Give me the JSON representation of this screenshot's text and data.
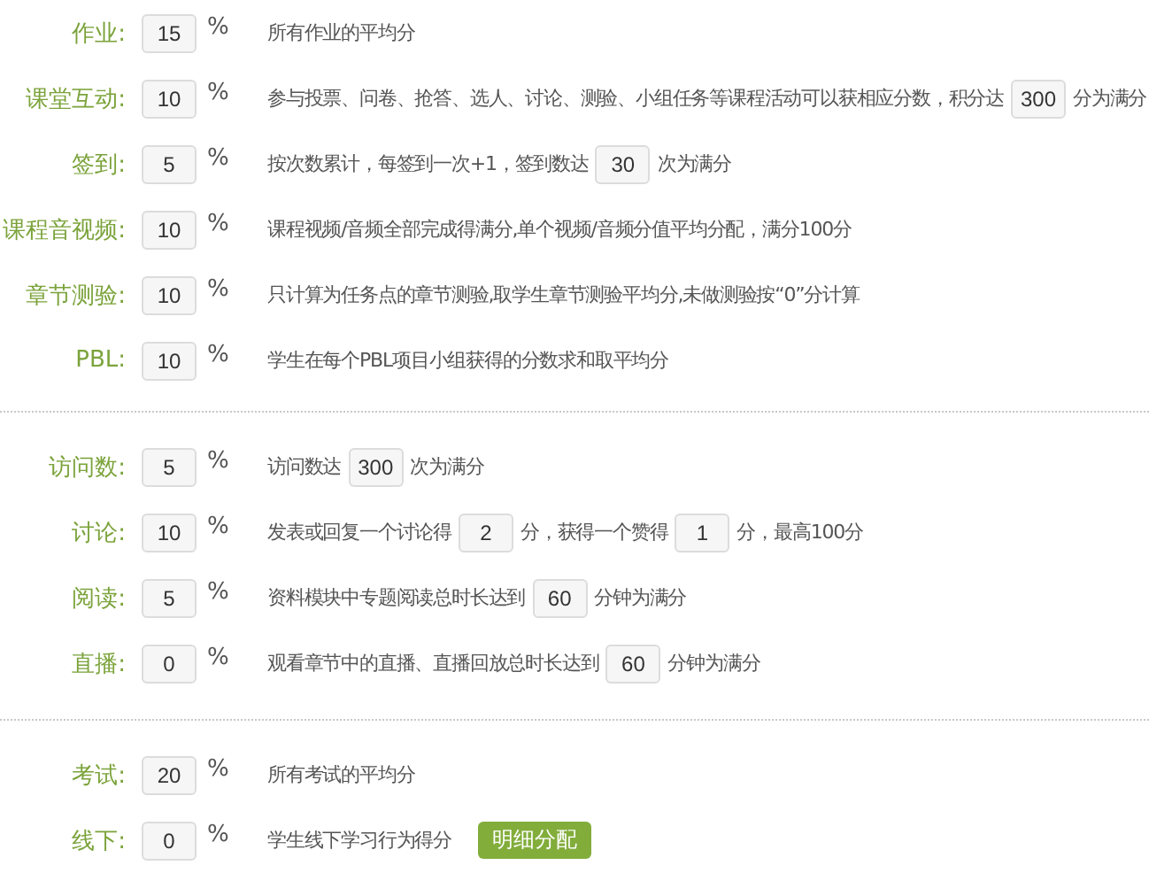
{
  "groups": [
    {
      "rows": [
        {
          "label": "作业:",
          "value": "15",
          "unit": "%",
          "description": [
            {
              "kind": "text",
              "text": "所有作业的平均分"
            }
          ]
        },
        {
          "label": "课堂互动:",
          "value": "10",
          "unit": "%",
          "description": [
            {
              "kind": "text",
              "text": "参与投票、问卷、抢答、选人、讨论、测验、小组任务等课程活动可以获相应分数，积分达"
            },
            {
              "kind": "input",
              "text": "300"
            },
            {
              "kind": "text",
              "text": "分为满分"
            }
          ]
        },
        {
          "label": "签到:",
          "value": "5",
          "unit": "%",
          "description": [
            {
              "kind": "text",
              "text": "按次数累计，每签到一次+1，签到数达"
            },
            {
              "kind": "input",
              "text": "30"
            },
            {
              "kind": "text",
              "text": "次为满分"
            }
          ]
        },
        {
          "label": "课程音视频:",
          "value": "10",
          "unit": "%",
          "description": [
            {
              "kind": "text",
              "text": "课程视频/音频全部完成得满分,单个视频/音频分值平均分配，满分100分"
            }
          ]
        },
        {
          "label": "章节测验:",
          "value": "10",
          "unit": "%",
          "description": [
            {
              "kind": "text",
              "text": "只计算为任务点的章节测验,取学生章节测验平均分,未做测验按“0”分计算"
            }
          ]
        },
        {
          "label": "PBL:",
          "value": "10",
          "unit": "%",
          "description": [
            {
              "kind": "text",
              "text": "学生在每个PBL项目小组获得的分数求和取平均分"
            }
          ]
        }
      ]
    },
    {
      "rows": [
        {
          "label": "访问数:",
          "value": "5",
          "unit": "%",
          "description": [
            {
              "kind": "text",
              "text": "访问数达"
            },
            {
              "kind": "input",
              "text": "300"
            },
            {
              "kind": "text",
              "text": "次为满分"
            }
          ]
        },
        {
          "label": "讨论:",
          "value": "10",
          "unit": "%",
          "description": [
            {
              "kind": "text",
              "text": "发表或回复一个讨论得"
            },
            {
              "kind": "input",
              "text": "2"
            },
            {
              "kind": "text",
              "text": "分，获得一个赞得"
            },
            {
              "kind": "input",
              "text": "1"
            },
            {
              "kind": "text",
              "text": "分，最高100分"
            }
          ]
        },
        {
          "label": "阅读:",
          "value": "5",
          "unit": "%",
          "description": [
            {
              "kind": "text",
              "text": "资料模块中专题阅读总时长达到"
            },
            {
              "kind": "input",
              "text": "60"
            },
            {
              "kind": "text",
              "text": "分钟为满分"
            }
          ]
        },
        {
          "label": "直播:",
          "value": "0",
          "unit": "%",
          "description": [
            {
              "kind": "text",
              "text": "观看章节中的直播、直播回放总时长达到"
            },
            {
              "kind": "input",
              "text": "60"
            },
            {
              "kind": "text",
              "text": "分钟为满分"
            }
          ]
        }
      ]
    },
    {
      "rows": [
        {
          "label": "考试:",
          "value": "20",
          "unit": "%",
          "description": [
            {
              "kind": "text",
              "text": "所有考试的平均分"
            }
          ]
        },
        {
          "label": "线下:",
          "value": "0",
          "unit": "%",
          "description": [
            {
              "kind": "text",
              "text": "学生线下学习行为得分"
            },
            {
              "kind": "button",
              "text": "明细分配"
            }
          ]
        }
      ]
    }
  ]
}
